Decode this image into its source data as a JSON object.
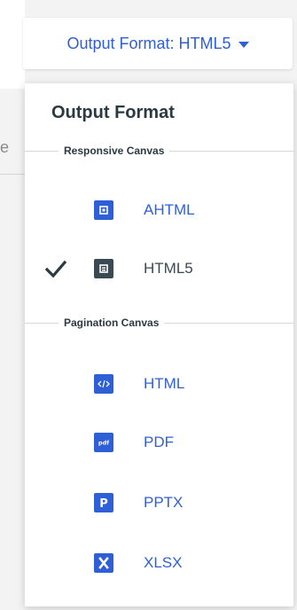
{
  "background": {
    "partial_text": "e"
  },
  "trigger": {
    "label": "Output Format: HTML5",
    "color": "#2f5fd6"
  },
  "menu": {
    "title": "Output Format",
    "groups": [
      {
        "label": "Responsive Canvas",
        "items": [
          {
            "label": "AHTML",
            "icon": "ahtml-icon",
            "selected": false,
            "color": "#2f5fd6"
          },
          {
            "label": "HTML5",
            "icon": "html5-icon",
            "selected": true,
            "color": "#3a4a52"
          }
        ]
      },
      {
        "label": "Pagination Canvas",
        "items": [
          {
            "label": "HTML",
            "icon": "html-code-icon",
            "selected": false,
            "color": "#2f5fd6"
          },
          {
            "label": "PDF",
            "icon": "pdf-icon",
            "selected": false,
            "color": "#2f5fd6"
          },
          {
            "label": "PPTX",
            "icon": "pptx-icon",
            "selected": false,
            "color": "#2f5fd6"
          },
          {
            "label": "XLSX",
            "icon": "xlsx-icon",
            "selected": false,
            "color": "#2f5fd6"
          }
        ]
      }
    ]
  }
}
